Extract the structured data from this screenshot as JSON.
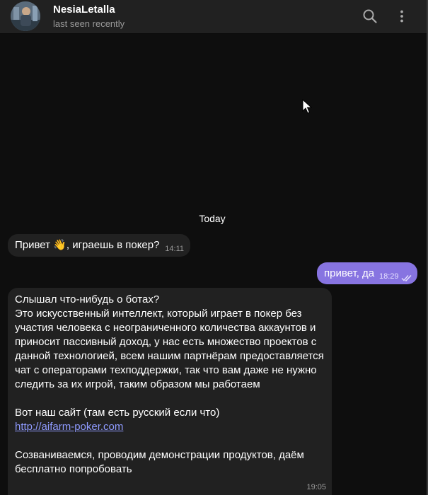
{
  "header": {
    "name": "NesiaLetalla",
    "status": "last seen recently"
  },
  "chat": {
    "date_separator": "Today",
    "messages": [
      {
        "direction": "incoming",
        "text_before_emoji": "Привет ",
        "emoji": "👋",
        "text_after_emoji": ", играешь в покер?",
        "time": "14:11"
      },
      {
        "direction": "outgoing",
        "text": "привет, да",
        "time": "18:29",
        "status_icon": "double-check-icon"
      },
      {
        "direction": "incoming",
        "paragraph1": "Слышал что-нибудь о ботах?",
        "paragraph2": "Это искусственный интеллект, который играет в покер без участия человека с неограниченного количества аккаунтов и приносит пассивный доход, у нас есть множество проектов с данной технологией, всем нашим партнёрам предоставляется чат с операторами техподдержки, так что вам даже не нужно следить за их игрой, таким образом мы работаем",
        "paragraph3": "Вот наш сайт (там есть русский если что)",
        "link": "http://aifarm-poker.com",
        "paragraph4": "Созваниваемся, проводим демонстрации продуктов, даём бесплатно попробовать",
        "time": "19:05"
      }
    ]
  },
  "colors": {
    "background": "#0e0e0e",
    "header": "#212121",
    "incoming_bubble": "#212121",
    "outgoing_bubble": "#8774e1",
    "link": "#8f9bff"
  },
  "icons": {
    "search": "search-icon",
    "menu": "more-vertical-icon"
  }
}
